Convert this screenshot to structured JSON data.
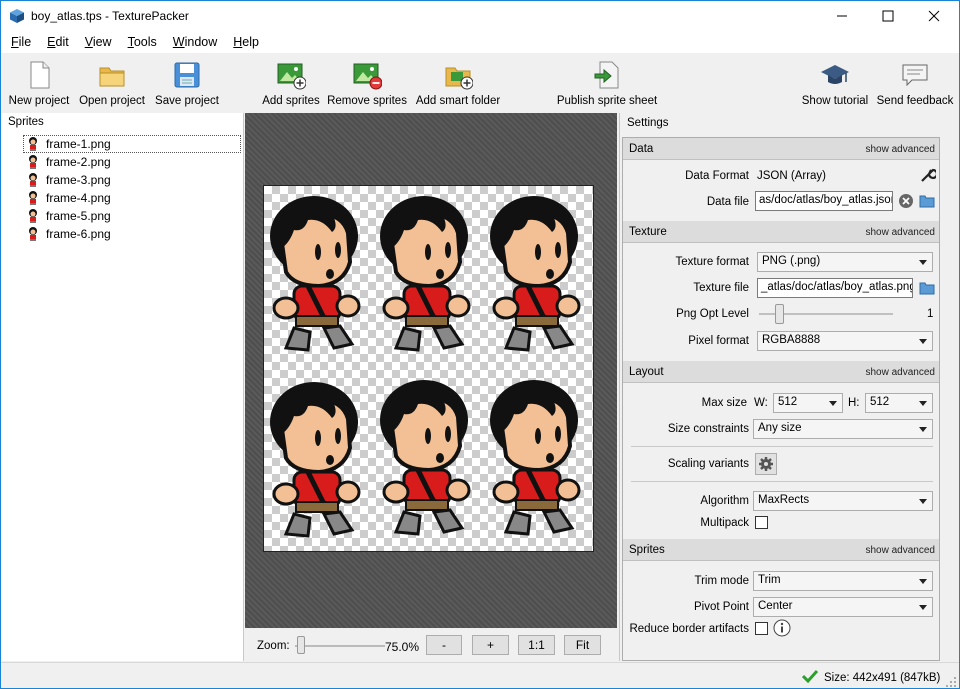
{
  "window": {
    "title": "boy_atlas.tps - TexturePacker"
  },
  "menu": [
    {
      "label": "File",
      "key": "F",
      "rest": "ile"
    },
    {
      "label": "Edit",
      "key": "E",
      "rest": "dit"
    },
    {
      "label": "View",
      "key": "V",
      "rest": "iew"
    },
    {
      "label": "Tools",
      "key": "T",
      "rest": "ools"
    },
    {
      "label": "Window",
      "key": "W",
      "rest": "indow"
    },
    {
      "label": "Help",
      "key": "H",
      "rest": "elp"
    }
  ],
  "toolbar": {
    "new_project": "New project",
    "open_project": "Open project",
    "save_project": "Save project",
    "add_sprites": "Add sprites",
    "remove_sprites": "Remove sprites",
    "add_smart_folder": "Add smart folder",
    "publish": "Publish sprite sheet",
    "show_tutorial": "Show tutorial",
    "send_feedback": "Send feedback"
  },
  "sprites_panel": {
    "caption": "Sprites",
    "items": [
      "frame-1.png",
      "frame-2.png",
      "frame-3.png",
      "frame-4.png",
      "frame-5.png",
      "frame-6.png"
    ]
  },
  "zoom": {
    "label": "Zoom:",
    "value": "75.0%",
    "minus": "-",
    "plus": "+",
    "one_to_one": "1:1",
    "fit": "Fit"
  },
  "settings": {
    "caption": "Settings",
    "show_advanced": "show advanced",
    "data": {
      "title": "Data",
      "data_format_label": "Data Format",
      "data_format_value": "JSON (Array)",
      "data_file_label": "Data file",
      "data_file_value": "as/doc/atlas/boy_atlas.json"
    },
    "texture": {
      "title": "Texture",
      "texture_format_label": "Texture format",
      "texture_format_value": "PNG (.png)",
      "texture_file_label": "Texture file",
      "texture_file_value": "_atlas/doc/atlas/boy_atlas.png",
      "png_opt_label": "Png Opt Level",
      "png_opt_value": "1",
      "pixel_format_label": "Pixel format",
      "pixel_format_value": "RGBA8888"
    },
    "layout": {
      "title": "Layout",
      "max_size_label": "Max size",
      "w_label": "W:",
      "w_value": "512",
      "h_label": "H:",
      "h_value": "512",
      "size_constraints_label": "Size constraints",
      "size_constraints_value": "Any size",
      "scaling_variants_label": "Scaling variants",
      "algorithm_label": "Algorithm",
      "algorithm_value": "MaxRects",
      "multipack_label": "Multipack"
    },
    "sprites": {
      "title": "Sprites",
      "trim_mode_label": "Trim mode",
      "trim_mode_value": "Trim",
      "pivot_point_label": "Pivot Point",
      "pivot_point_value": "Center",
      "reduce_border_label": "Reduce border artifacts"
    }
  },
  "status": {
    "size_text": "Size: 442x491 (847kB)"
  },
  "colors": {
    "accent": "#1883d7",
    "ok_green": "#2ca02c",
    "shirt_red": "#d81b1b",
    "skin": "#f2c094"
  }
}
